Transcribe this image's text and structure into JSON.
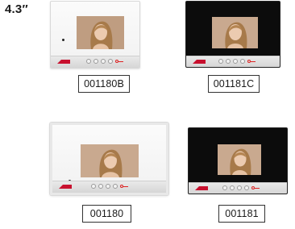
{
  "size_label": "4.3″",
  "products": [
    {
      "code": "001180B",
      "finish": "white",
      "brand_color": "#c8102e"
    },
    {
      "code": "001181C",
      "finish": "black",
      "brand_color": "#c8102e"
    },
    {
      "code": "001180",
      "finish": "white",
      "brand_color": "#c8102e"
    },
    {
      "code": "001181",
      "finish": "black",
      "brand_color": "#c8102e"
    }
  ]
}
